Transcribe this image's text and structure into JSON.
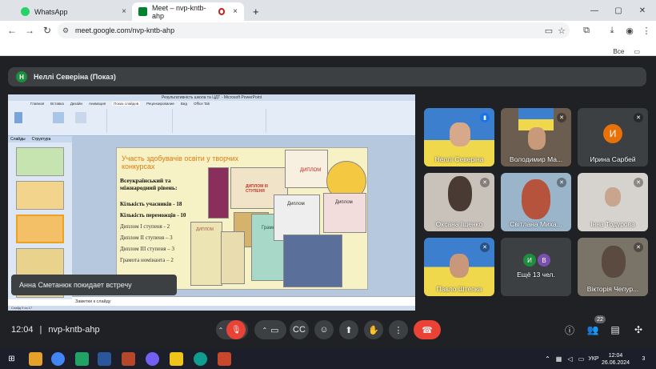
{
  "browser": {
    "tabs": [
      {
        "label": "WhatsApp",
        "close": "×"
      },
      {
        "label": "Meet – nvp-kntb-ahp",
        "close": "×"
      }
    ],
    "new_tab": "+",
    "win": {
      "min": "—",
      "max": "▢",
      "close": "✕"
    },
    "url": "meet.google.com/nvp-kntb-ahp",
    "bookmarks_label": "Все закладки"
  },
  "presenter": {
    "initial": "Н",
    "label": "Неллі Северіна (Показ)"
  },
  "ppt": {
    "title": "Результативність школа та ЦДТ - Microsoft PowerPoint",
    "tabs": [
      "Главная",
      "Вставка",
      "Дизайн",
      "Анимация",
      "Показ слайдов",
      "Рецензирование",
      "Вид",
      "Office Tab"
    ],
    "pane_tabs": [
      "Слайды",
      "Структура"
    ],
    "notes": "Заметки к слайду",
    "status": "Слайд 9 из 17"
  },
  "slide": {
    "heading": "Участь здобувачів освіти у творчих конкурсах",
    "level": "Всеукраїнський та міжнародний рівень:",
    "lines": [
      "Кількість учасників - 18",
      "Кількість переможців - 10",
      "Диплом І ступеня - 2",
      "Диплом ІІ ступеня – 3",
      "Диплом ІІІ ступеня – 3",
      "Грамота номінанта – 2"
    ],
    "dip1": "ДИПЛОМ ІІІ СТУПЕНЯ",
    "dip2": "Диплом",
    "dip3": "Диплом",
    "dip4": "Грамота",
    "dip5": "ДИПЛОМ",
    "dip6": "ДИПЛОМ"
  },
  "participants": [
    {
      "name": "Неллі Северіна"
    },
    {
      "name": "Володимир Ма..."
    },
    {
      "name": "Ирина Сарбей",
      "initial": "И"
    },
    {
      "name": "Оксана Іщенко"
    },
    {
      "name": "Світлана Миха..."
    },
    {
      "name": "Інна Тодурова"
    },
    {
      "name": "Павло Штепка"
    },
    {
      "name": "Ещё 13 чел.",
      "initials": [
        "И",
        "В"
      ]
    },
    {
      "name": "Вікторія Чепур..."
    }
  ],
  "toast": "Анна Сметанюк покидает встречу",
  "meeting": {
    "time": "12:04",
    "separator": "|",
    "code": "nvp-kntb-ahp",
    "people_count": "22"
  },
  "taskbar": {
    "time": "12:04",
    "date": "26.06.2024",
    "lang": "УКР",
    "notif": "3"
  },
  "colors": {
    "end_call": "#ea4335",
    "mic_off": "#ea4335",
    "accent": "#1a73e8"
  }
}
